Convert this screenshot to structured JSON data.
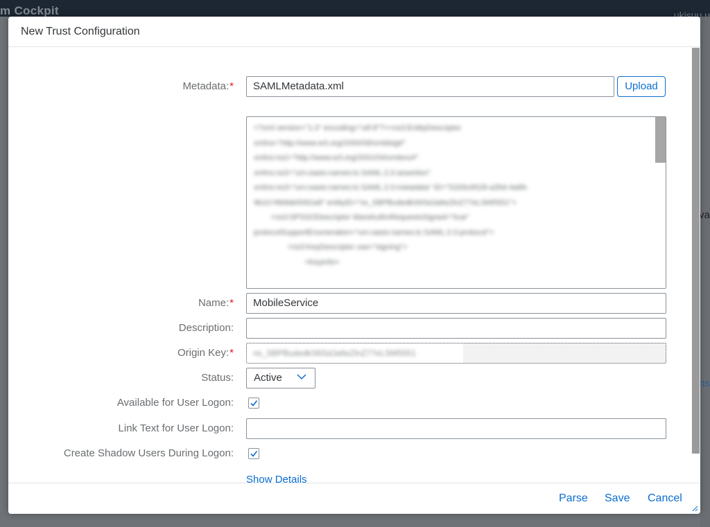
{
  "background": {
    "brand_text": "m Cockpit",
    "user_text": "ukisuu u",
    "right_text_1": "va",
    "right_text_2": "ns"
  },
  "dialog": {
    "title": "New Trust Configuration",
    "metadata": {
      "label": "Metadata:",
      "required": "*",
      "value": "SAMLMetadata.xml",
      "upload_label": "Upload"
    },
    "metadata_preview": "<?xml version=\"1.0\" encoding=\"utf-8\"?><ns3:EntityDescriptor\nxmlns=\"http://www.w3.org/2000/09/xmldsig#\"\nxmlns:ns2=\"http://www.w3.org/2001/04/xmlenc#\"\nxmlns:ns3=\"urn:oasis:names:tc:SAML:2.0:assertion\"\nxmlns:ns3=\"urn:oasis:names:tc:SAML:2.0:metadata\" ID=\"S2d3c6528-a35d-4a86-\n9b10-f4b8de5062a8\" entityID=\"ns_SBPBudedkS6SdJa6eZlnZ77eLSM5551\">\n        <ns3:SPSSODescriptor WantAuthnRequestsSigned=\"true\"\nprotocolSupportEnumeration=\"urn:oasis:names:tc:SAML:2.0:protocol\">\n                <ns3:KeyDescriptor use=\"signing\">\n                        <KeyInfo>",
    "name": {
      "label": "Name:",
      "required": "*",
      "value": "MobileService"
    },
    "description": {
      "label": "Description:",
      "value": ""
    },
    "origin_key": {
      "label": "Origin Key:",
      "required": "*",
      "value": "ns_SBPBudedkS6SdJa6eZlnZ77eLSM5551"
    },
    "status": {
      "label": "Status:",
      "value": "Active"
    },
    "available_for_logon": {
      "label": "Available for User Logon:",
      "checked": true
    },
    "link_text": {
      "label": "Link Text for User Logon:",
      "value": ""
    },
    "shadow_users": {
      "label": "Create Shadow Users During Logon:",
      "checked": true
    },
    "show_details": "Show Details",
    "footer": {
      "parse": "Parse",
      "save": "Save",
      "cancel": "Cancel"
    }
  },
  "colors": {
    "accent": "#0a6ed1",
    "required": "#e0161d",
    "label": "#6a6d70",
    "text": "#32363a"
  }
}
